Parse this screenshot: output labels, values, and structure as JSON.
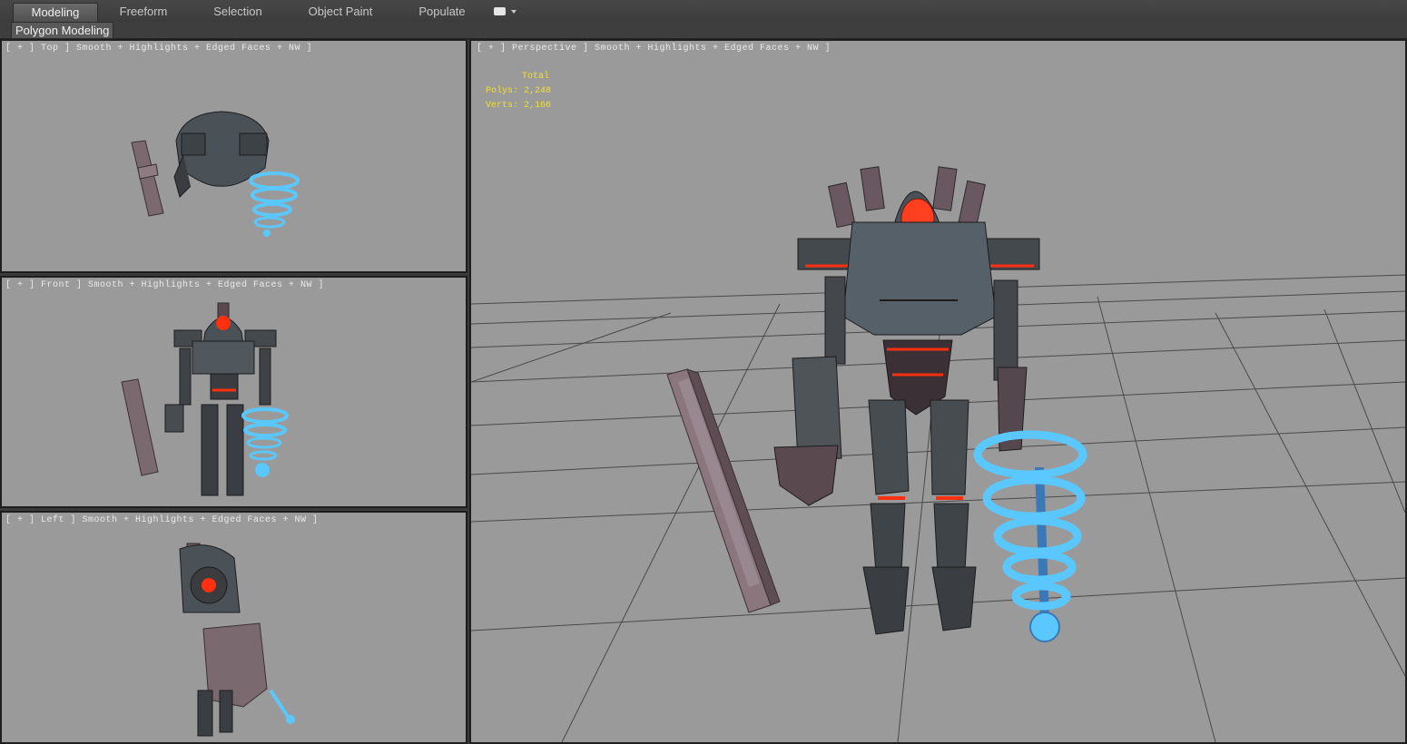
{
  "ribbon": {
    "tabs": [
      {
        "label": "Modeling",
        "active": true
      },
      {
        "label": "Freeform",
        "active": false
      },
      {
        "label": "Selection",
        "active": false
      },
      {
        "label": "Object Paint",
        "active": false
      },
      {
        "label": "Populate",
        "active": false
      }
    ],
    "panel_label": "Polygon Modeling"
  },
  "viewports": {
    "top": {
      "label": "[ + ] Top ] Smooth + Highlights + Edged Faces + NW ]"
    },
    "front": {
      "label": "[ + ] Front ] Smooth + Highlights + Edged Faces + NW ]"
    },
    "left": {
      "label": "[ + ] Left ] Smooth + Highlights + Edged Faces + NW ]"
    },
    "perspective": {
      "label": "[ + ] Perspective ] Smooth + Highlights + Edged Faces + NW ]",
      "stats": {
        "header": "Total",
        "polys": "Polys: 2,248",
        "verts": "Verts: 2,166"
      }
    }
  },
  "colors": {
    "viewport_bg": "#9a9a9a",
    "stats_text": "#f0e030",
    "robot_armor": "#4a5258",
    "robot_glow": "#ff3010",
    "drill_blue": "#5ac8ff"
  }
}
